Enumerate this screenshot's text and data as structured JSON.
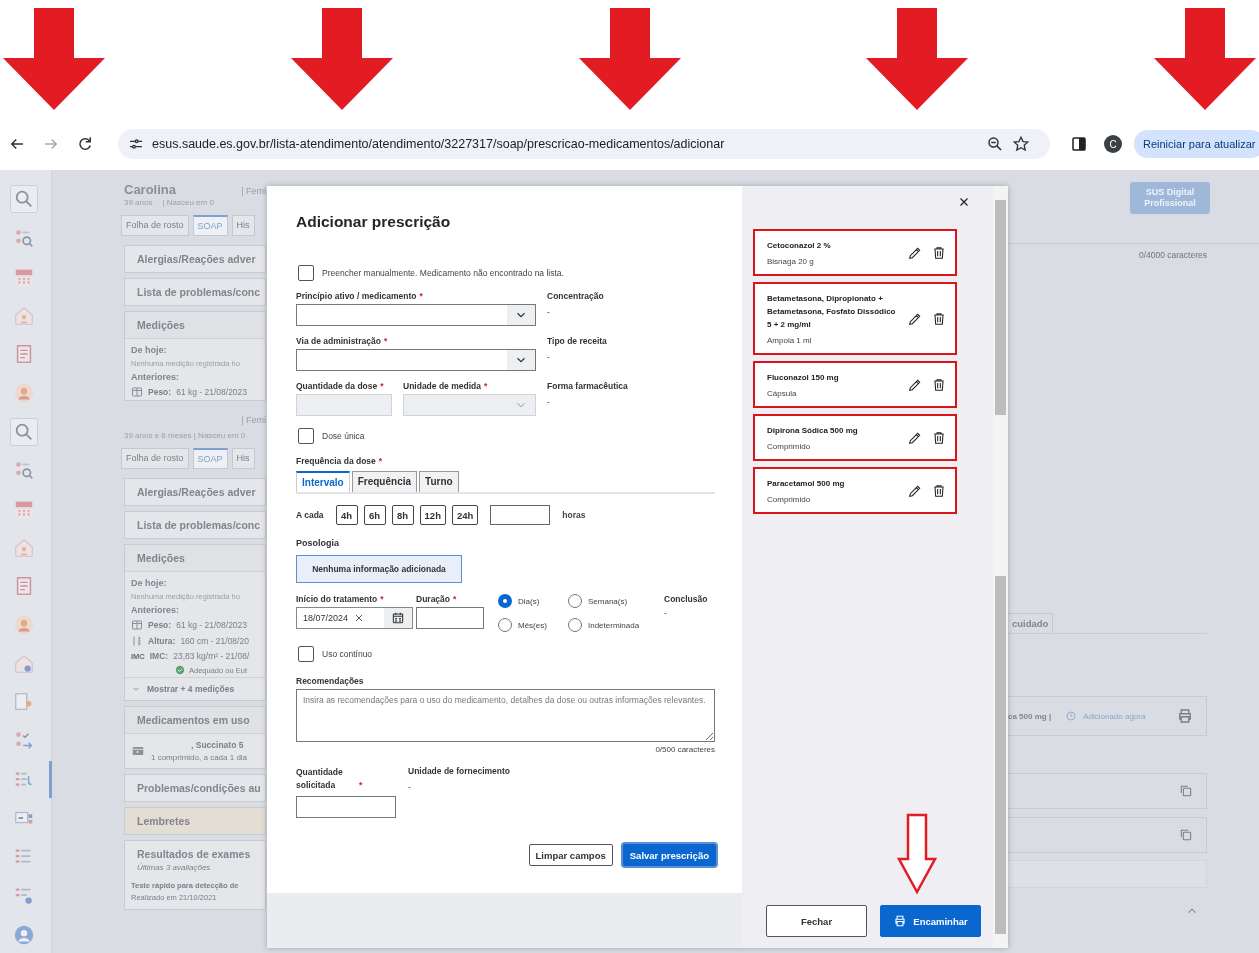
{
  "annotations": {
    "top_arrows": [
      {
        "kind": "filled"
      },
      {
        "kind": "filled"
      },
      {
        "kind": "filled"
      },
      {
        "kind": "filled"
      },
      {
        "kind": "filled"
      }
    ],
    "pointer": {
      "kind": "outline"
    }
  },
  "browser": {
    "url": "esus.saude.es.gov.br/lista-atendimento/atendimento/3227317/soap/prescricao-medicamentos/adicionar",
    "profile_initial": "C",
    "update_button": "Reiniciar para atualizar"
  },
  "sidebar": {
    "items": [
      {
        "kind": "search",
        "selected": false
      },
      {
        "kind": "people-search",
        "selected": false
      },
      {
        "kind": "calendar",
        "selected": false
      },
      {
        "kind": "house",
        "selected": false
      },
      {
        "kind": "document",
        "selected": false
      },
      {
        "kind": "person",
        "selected": false
      },
      {
        "kind": "search",
        "selected": false
      },
      {
        "kind": "people-search",
        "selected": false
      },
      {
        "kind": "calendar",
        "selected": false
      },
      {
        "kind": "house",
        "selected": false
      },
      {
        "kind": "document",
        "selected": false
      },
      {
        "kind": "person",
        "selected": false
      },
      {
        "kind": "house-gear",
        "selected": false
      },
      {
        "kind": "document-person",
        "selected": false
      },
      {
        "kind": "checklist",
        "selected": false
      },
      {
        "kind": "list-stethoscope",
        "selected": true
      },
      {
        "kind": "screen",
        "selected": false
      },
      {
        "kind": "list",
        "selected": false
      },
      {
        "kind": "list-gear",
        "selected": false
      },
      {
        "kind": "avatar",
        "selected": false
      }
    ]
  },
  "patient_panels": [
    {
      "name": "Carolina",
      "gender": "| Femi",
      "age": "39 anos",
      "birth": "| Nasceu em 0",
      "tabs": [
        {
          "label": "Folha de rosto",
          "selected": false
        },
        {
          "label": "SOAP",
          "selected": true
        },
        {
          "label": "His",
          "selected": false
        }
      ],
      "sections": [
        {
          "kind": "collapsed",
          "title": "Alergias/Reações adver"
        },
        {
          "kind": "collapsed",
          "title": "Lista de problemas/conc"
        },
        {
          "kind": "measurements",
          "title": "Medições",
          "today_label": "De hoje:",
          "today_text": "Nenhuma medição registrada ho",
          "previous_label": "Anteriores:",
          "rows": [
            {
              "kind": "weight",
              "label": "Peso:",
              "value": "61 kg - 21/08/2023"
            }
          ]
        }
      ]
    },
    {
      "gender": "| Femi",
      "age": "39 anos e 6 meses | Nasceu em 0",
      "tabs": [
        {
          "label": "Folha de rosto",
          "selected": false
        },
        {
          "label": "SOAP",
          "selected": true
        },
        {
          "label": "His",
          "selected": false
        }
      ],
      "sections": [
        {
          "kind": "collapsed",
          "title": "Alergias/Reações adver"
        },
        {
          "kind": "collapsed",
          "title": "Lista de problemas/conc"
        },
        {
          "kind": "measurements",
          "title": "Medições",
          "today_label": "De hoje:",
          "today_text": "Nenhuma medição registrada ho",
          "previous_label": "Anteriores:",
          "rows": [
            {
              "kind": "weight",
              "label": "Peso:",
              "value": "61 kg - 21/08/2023"
            },
            {
              "kind": "height",
              "label": "Altura:",
              "value": "160 cm - 21/08/20"
            },
            {
              "kind": "bmi",
              "icon_text": "IMC",
              "label": "IMC:",
              "value": "23,83 kg/m² - 21/08/",
              "status": "Adequado ou Eut"
            }
          ],
          "more": "Mostrar + 4 medições"
        },
        {
          "kind": "medications",
          "title": "Medicamentos em uso",
          "items": [
            {
              "name": ", Succinato 5",
              "dose": "1 comprimido, a cada 1 dia"
            }
          ]
        },
        {
          "kind": "collapsed",
          "title": "Problemas/condições au"
        },
        {
          "kind": "reminder",
          "title": "Lembretes"
        },
        {
          "kind": "exams",
          "title": "Resultados de exames",
          "subtitle": "Últimas 3 avaliações",
          "test": "Teste rápido para detecção de",
          "date": "Realizado em 21/10/2021"
        }
      ]
    }
  ],
  "right_area": {
    "sus_button": "SUS Digital Profissional",
    "char_counter": "0/4000 caracteres",
    "tab": "cuidado",
    "card": {
      "text": "ca 500 mg |",
      "status": "Adicionado agora"
    }
  },
  "modal": {
    "title": "Adicionar prescrição",
    "manual_checkbox": {
      "label": "Preencher manualmente. Medicamento não encontrado na lista.",
      "checked": false
    },
    "rows": [
      {
        "fields": [
          {
            "kind": "select",
            "label": "Princípio ativo / medicamento",
            "required_mark": "*",
            "disabled": false
          }
        ],
        "info": {
          "label": "Concentração",
          "value": "-"
        }
      },
      {
        "fields": [
          {
            "kind": "select",
            "label": "Via de administração",
            "required_mark": "*",
            "disabled": false
          }
        ],
        "info": {
          "label": "Tipo de receita",
          "value": "-"
        }
      },
      {
        "fields": [
          {
            "kind": "input",
            "label": "Quantidade da dose",
            "required_mark": "*",
            "disabled": true
          },
          {
            "kind": "select",
            "label": "Unidade de medida",
            "required_mark": "*",
            "disabled": true
          }
        ],
        "info": {
          "label": "Forma farmacêutica",
          "value": "-"
        }
      }
    ],
    "single_dose": {
      "label": "Dose única",
      "checked": false
    },
    "frequency": {
      "label": "Frequência da dose",
      "required_mark": "*",
      "tabs": [
        {
          "label": "Intervalo",
          "selected": true
        },
        {
          "label": "Frequência",
          "selected": false
        },
        {
          "label": "Turno",
          "selected": false
        }
      ],
      "prefix": "A cada",
      "options": [
        {
          "label": "4h",
          "selected": false
        },
        {
          "label": "6h",
          "selected": false
        },
        {
          "label": "8h",
          "selected": false
        },
        {
          "label": "12h",
          "selected": false
        },
        {
          "label": "24h",
          "selected": false
        }
      ],
      "unit": "horas"
    },
    "posology": {
      "label": "Posologia",
      "value": "Nenhuma informação adicionada"
    },
    "treatment": {
      "start": {
        "label": "Início do tratamento",
        "required_mark": "*",
        "value": "18/07/2024"
      },
      "duration": {
        "label": "Duração",
        "required_mark": "*"
      },
      "periods": [
        {
          "label": "Dia(s)",
          "selected": true
        },
        {
          "label": "Semana(s)",
          "selected": false
        },
        {
          "label": "Mês(es)",
          "selected": false
        },
        {
          "label": "Indeterminada",
          "selected": false
        }
      ],
      "conclusion": {
        "label": "Conclusão",
        "value": "-"
      }
    },
    "continuous_use": {
      "label": "Uso contínuo",
      "checked": false
    },
    "recommendations": {
      "label": "Recomendações",
      "placeholder": "Insira as recomendações para o uso do medicamento, detalhes da dose ou outras informações relevantes.",
      "counter": "0/500 caracteres"
    },
    "quantity": {
      "label": "Quantidade solicitada",
      "required_mark": "*"
    },
    "supply_unit": {
      "label": "Unidade de fornecimento",
      "value": "-"
    },
    "buttons": [
      {
        "label": "Limpar campos",
        "kind": "secondary"
      },
      {
        "label": "Salvar prescrição",
        "kind": "primary"
      }
    ],
    "prescriptions": [
      {
        "name": "Cetoconazol 2 %",
        "form": "Bisnaga 20 g",
        "highlighted": true
      },
      {
        "name": "Betametasona, Dipropionato + Betametasona, Fosfato Dissódico 5 + 2 mg/ml",
        "form": "Ampola 1 ml",
        "highlighted": true
      },
      {
        "name": "Fluconazol 150 mg",
        "form": "Cápsula",
        "highlighted": true
      },
      {
        "name": "Dipirona Sódica 500 mg",
        "form": "Comprimido",
        "highlighted": true
      },
      {
        "name": "Paracetamol 500 mg",
        "form": "Comprimido",
        "highlighted": true
      }
    ],
    "footer_buttons": [
      {
        "label": "Fechar",
        "kind": "secondary"
      },
      {
        "label": "Encaminhar",
        "kind": "primary"
      }
    ]
  }
}
